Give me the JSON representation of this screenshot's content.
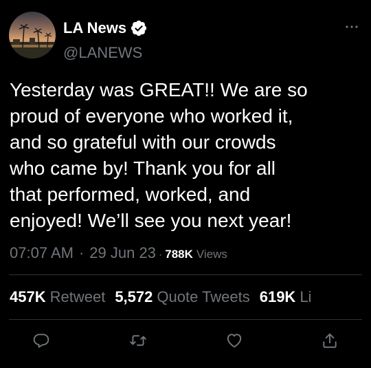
{
  "tweet": {
    "author": {
      "display_name": "LA News",
      "handle": "@LANEWS",
      "verified": true,
      "avatar_icon": "sunset-palm-trees-avatar"
    },
    "more_icon": "more-horizontal-icon",
    "text_lines": [
      "Yesterday was GREAT!! We are so",
      "proud of everyone who worked it,",
      "and so grateful with our crowds",
      "who came by! Thank you for all",
      "that performed, worked, and",
      "enjoyed! We’ll see you next year!"
    ],
    "meta": {
      "time": "07:07 AM",
      "separator": "·",
      "date": "29 Jun 23",
      "views_count": "788K",
      "views_label": "Views"
    },
    "stats": {
      "retweets_count": "457K",
      "retweets_label": "Retweet",
      "quotes_count": "5,572",
      "quotes_label": "Quote Tweets",
      "likes_count": "619K",
      "likes_label": "Li"
    },
    "actions": [
      "reply-icon",
      "retweet-icon",
      "like-icon",
      "share-icon"
    ]
  },
  "colors": {
    "background": "#000000",
    "text_primary": "#ffffff",
    "text_secondary": "#71767b",
    "divider": "#2f3336",
    "verified_badge": "#ffffff"
  }
}
